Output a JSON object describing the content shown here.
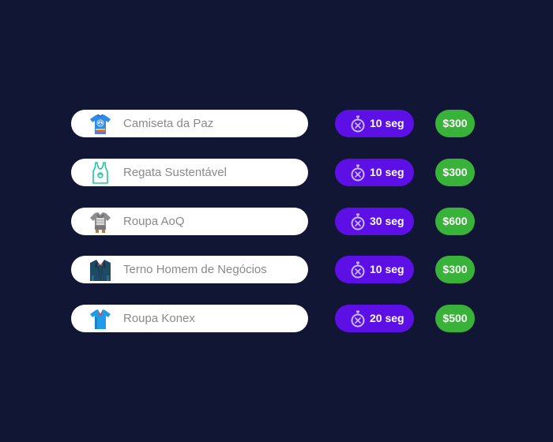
{
  "items": [
    {
      "name": "Camiseta da Paz",
      "icon": "peace-tshirt-icon",
      "time": "10 seg",
      "price": "$300"
    },
    {
      "name": "Regata Sustentável",
      "icon": "tank-top-icon",
      "time": "10 seg",
      "price": "$300"
    },
    {
      "name": "Roupa AoQ",
      "icon": "armor-outfit-icon",
      "time": "30 seg",
      "price": "$600"
    },
    {
      "name": "Terno Homem de Negócios",
      "icon": "business-suit-icon",
      "time": "10 seg",
      "price": "$300"
    },
    {
      "name": "Roupa Konex",
      "icon": "blue-shirt-icon",
      "time": "20 seg",
      "price": "$500"
    }
  ],
  "colors": {
    "background": "#111634",
    "item_pill": "#ffffff",
    "item_text": "#8a8a8a",
    "time_pill": "#5d10e6",
    "price_pill": "#39b23a"
  }
}
